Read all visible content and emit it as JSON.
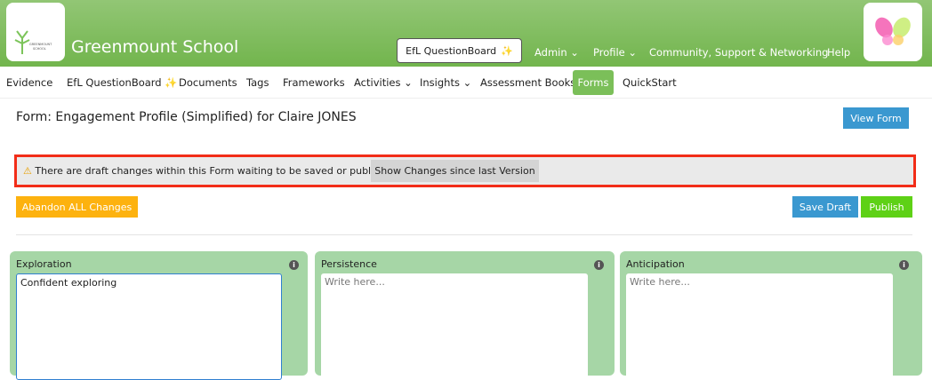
{
  "header": {
    "school_name": "Greenmount School",
    "efl_button": "EfL QuestionBoard",
    "nav": [
      "Admin",
      "Profile",
      "Community, Support & Networking",
      "Help"
    ]
  },
  "nav": {
    "items": [
      "Evidence",
      "EfL QuestionBoard",
      "Documents",
      "Tags",
      "Frameworks",
      "Activities",
      "Insights",
      "Assessment Books",
      "Forms",
      "QuickStart"
    ],
    "active": "Forms"
  },
  "form": {
    "title": "Form: Engagement Profile (Simplified) for Claire JONES",
    "view_form": "View Form"
  },
  "warning": {
    "text": "There are draft changes within this Form waiting to be saved or published.",
    "show_changes": "Show Changes since last Version"
  },
  "actions": {
    "abandon": "Abandon ALL Changes",
    "save_draft": "Save Draft",
    "publish": "Publish"
  },
  "cards": [
    {
      "label": "Exploration",
      "value": "Confident exploring",
      "placeholder": "Write here..."
    },
    {
      "label": "Persistence",
      "value": "",
      "placeholder": "Write here..."
    },
    {
      "label": "Anticipation",
      "value": "",
      "placeholder": "Write here..."
    }
  ]
}
